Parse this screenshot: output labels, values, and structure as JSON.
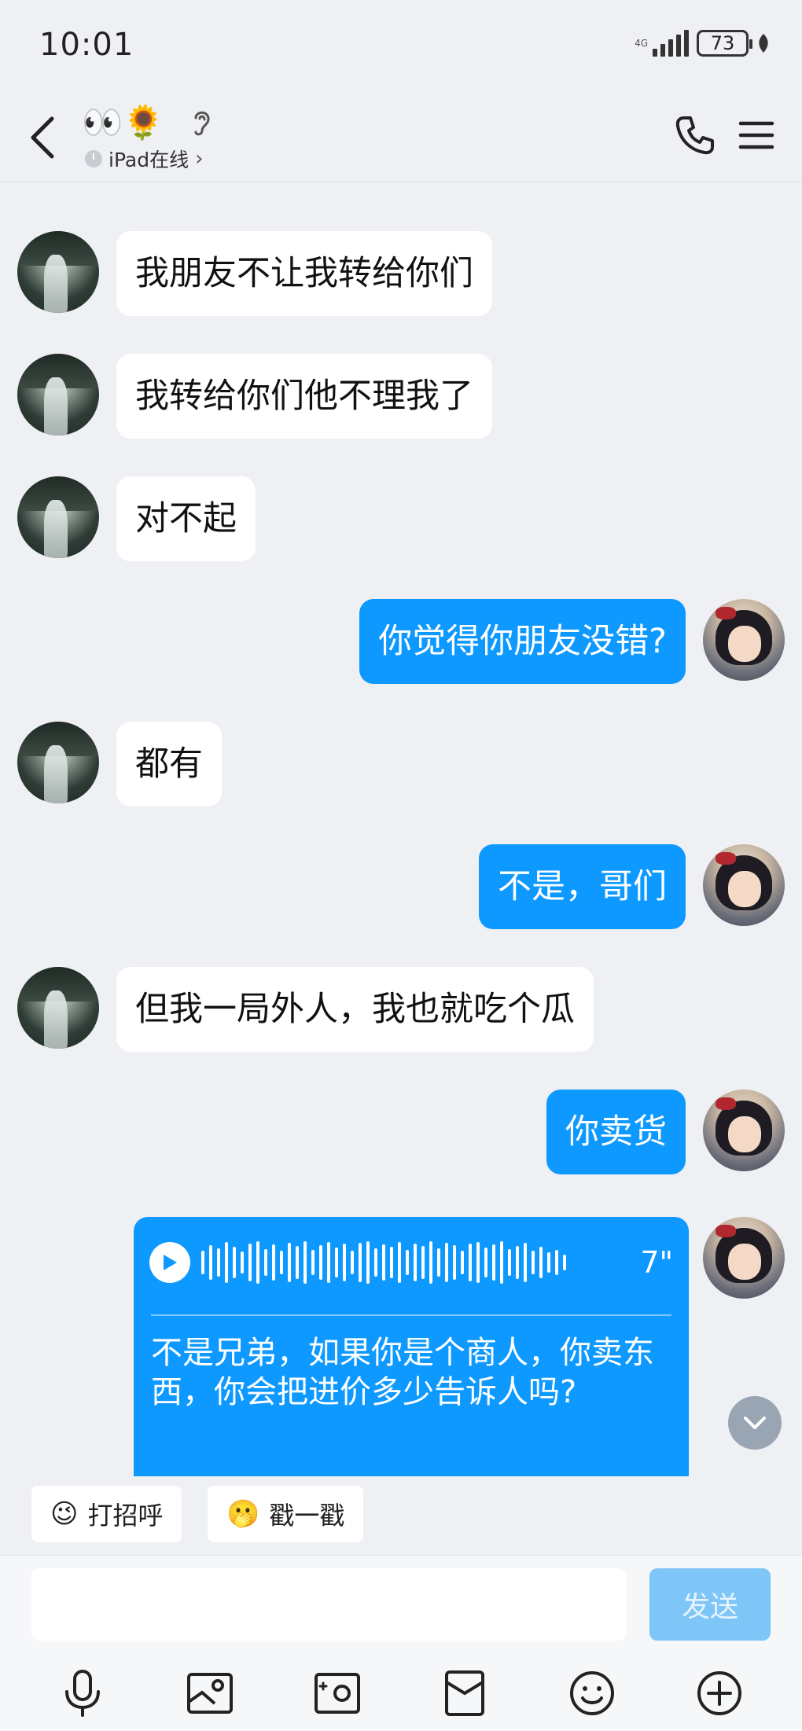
{
  "status_bar": {
    "time": "10:01",
    "battery": "73",
    "network_label": "4G"
  },
  "header": {
    "contact_emoji": "👀🌻",
    "online_status": "iPad在线"
  },
  "messages": [
    {
      "side": "in",
      "text": "我朋友不让我转给你们"
    },
    {
      "side": "in",
      "text": "我转给你们他不理我了"
    },
    {
      "side": "in",
      "text": "对不起"
    },
    {
      "side": "out",
      "text": "你觉得你朋友没错?"
    },
    {
      "side": "in",
      "text": "都有"
    },
    {
      "side": "out",
      "text": "不是，哥们"
    },
    {
      "side": "in",
      "text": "但我一局外人，我也就吃个瓜"
    },
    {
      "side": "out",
      "text": "你卖货"
    }
  ],
  "voice_message": {
    "duration": "7\"",
    "transcript": "不是兄弟，如果你是个商人，你卖东西，你会把进价多少告诉人吗?"
  },
  "quick_replies": [
    {
      "emoji": "😉",
      "label": "打招呼"
    },
    {
      "emoji": "🫢",
      "label": "戳一戳"
    }
  ],
  "input": {
    "placeholder": "",
    "send_label": "发送"
  },
  "toolbar": [
    "mic-icon",
    "image-icon",
    "camera-icon",
    "red-packet-icon",
    "emoji-icon",
    "plus-icon"
  ],
  "colors": {
    "bubble_out": "#0d99ff",
    "bubble_in": "#ffffff",
    "background": "#eef0f3",
    "send_disabled": "#7ec5f8"
  }
}
